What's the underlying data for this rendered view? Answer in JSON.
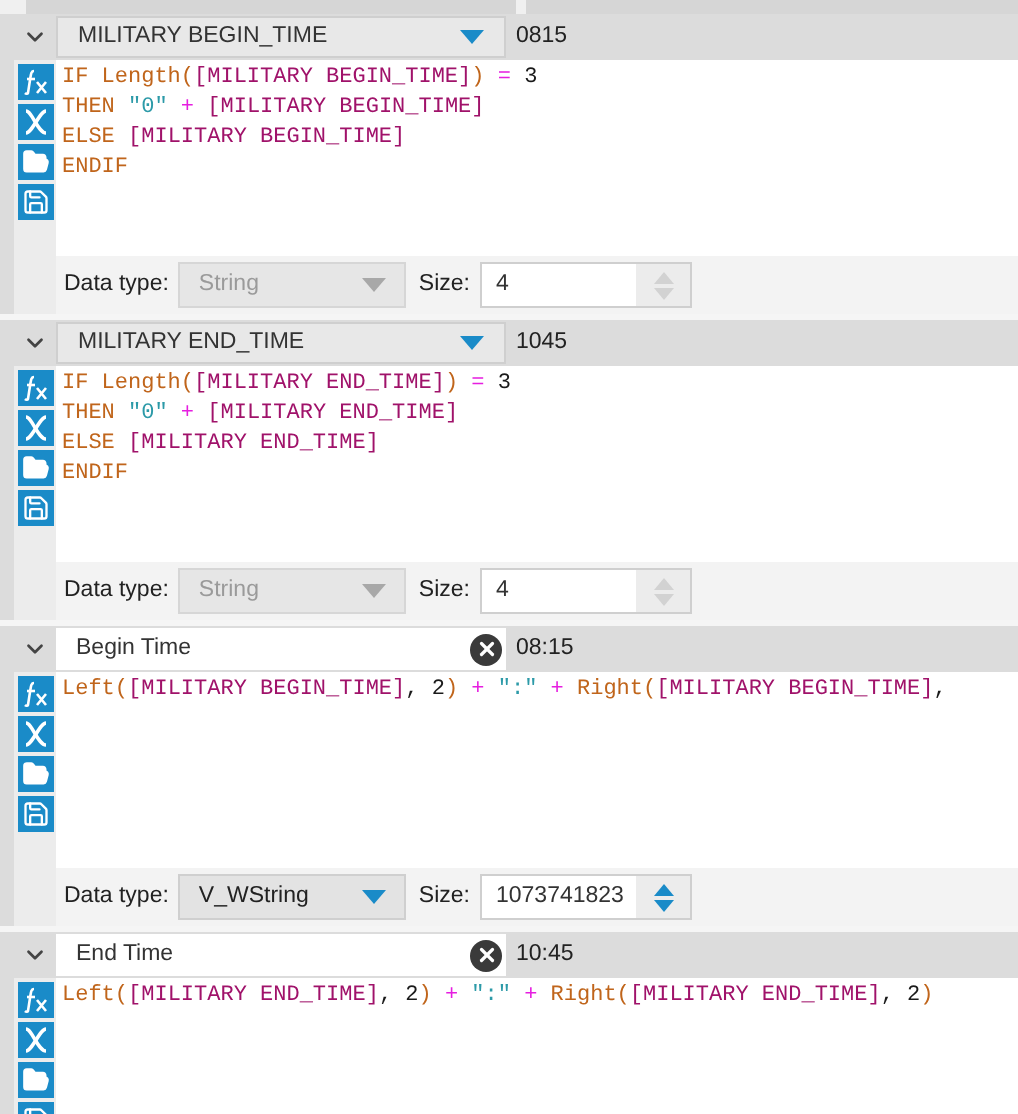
{
  "panels": [
    {
      "expanded": true,
      "field": {
        "kind": "dropdown",
        "value": "MILITARY BEGIN_TIME"
      },
      "preview": "0815",
      "code": [
        [
          {
            "kind": "keyword",
            "s": "IF Length("
          },
          {
            "kind": "field",
            "s": "[MILITARY BEGIN_TIME]"
          },
          {
            "kind": "keyword",
            "s": ")"
          },
          {
            "kind": "op",
            "s": " = "
          },
          {
            "kind": "number",
            "s": "3"
          }
        ],
        [
          {
            "kind": "keyword",
            "s": "THEN "
          },
          {
            "kind": "string",
            "s": "\"0\""
          },
          {
            "kind": "op",
            "s": " + "
          },
          {
            "kind": "field",
            "s": "[MILITARY BEGIN_TIME]"
          }
        ],
        [
          {
            "kind": "keyword",
            "s": "ELSE "
          },
          {
            "kind": "field",
            "s": "[MILITARY BEGIN_TIME]"
          }
        ],
        [
          {
            "kind": "keyword",
            "s": "ENDIF"
          }
        ]
      ],
      "footer": {
        "data_type_label": "Data type:",
        "data_type": "String",
        "disabled": true,
        "size_label": "Size:",
        "size": "4"
      }
    },
    {
      "expanded": true,
      "field": {
        "kind": "dropdown",
        "value": "MILITARY END_TIME"
      },
      "preview": "1045",
      "code": [
        [
          {
            "kind": "keyword",
            "s": "IF Length("
          },
          {
            "kind": "field",
            "s": "[MILITARY END_TIME]"
          },
          {
            "kind": "keyword",
            "s": ")"
          },
          {
            "kind": "op",
            "s": " = "
          },
          {
            "kind": "number",
            "s": "3"
          }
        ],
        [
          {
            "kind": "keyword",
            "s": "THEN "
          },
          {
            "kind": "string",
            "s": "\"0\""
          },
          {
            "kind": "op",
            "s": " + "
          },
          {
            "kind": "field",
            "s": "[MILITARY END_TIME]"
          }
        ],
        [
          {
            "kind": "keyword",
            "s": "ELSE "
          },
          {
            "kind": "field",
            "s": "[MILITARY END_TIME]"
          }
        ],
        [
          {
            "kind": "keyword",
            "s": "ENDIF"
          }
        ]
      ],
      "footer": {
        "data_type_label": "Data type:",
        "data_type": "String",
        "disabled": true,
        "size_label": "Size:",
        "size": "4"
      }
    },
    {
      "expanded": true,
      "field": {
        "kind": "text",
        "value": "Begin Time"
      },
      "preview": "08:15",
      "code": [
        [
          {
            "kind": "keyword",
            "s": "Left("
          },
          {
            "kind": "field",
            "s": "[MILITARY BEGIN_TIME]"
          },
          {
            "kind": "number",
            "s": ", 2"
          },
          {
            "kind": "keyword",
            "s": ")"
          },
          {
            "kind": "op",
            "s": " + "
          },
          {
            "kind": "string",
            "s": "\":\""
          },
          {
            "kind": "op",
            "s": " + "
          },
          {
            "kind": "keyword",
            "s": "Right("
          },
          {
            "kind": "field",
            "s": "[MILITARY BEGIN_TIME]"
          },
          {
            "kind": "number",
            "s": ","
          }
        ]
      ],
      "footer": {
        "data_type_label": "Data type:",
        "data_type": "V_WString",
        "disabled": false,
        "size_label": "Size:",
        "size": "1073741823"
      }
    },
    {
      "expanded": true,
      "field": {
        "kind": "text",
        "value": "End Time"
      },
      "preview": "10:45",
      "code": [
        [
          {
            "kind": "keyword",
            "s": "Left("
          },
          {
            "kind": "field",
            "s": "[MILITARY END_TIME]"
          },
          {
            "kind": "number",
            "s": ", 2"
          },
          {
            "kind": "keyword",
            "s": ")"
          },
          {
            "kind": "op",
            "s": " + "
          },
          {
            "kind": "string",
            "s": "\":\""
          },
          {
            "kind": "op",
            "s": " + "
          },
          {
            "kind": "keyword",
            "s": "Right("
          },
          {
            "kind": "field",
            "s": "[MILITARY END_TIME]"
          },
          {
            "kind": "number",
            "s": ", 2"
          },
          {
            "kind": "keyword",
            "s": ")"
          }
        ]
      ]
    }
  ]
}
